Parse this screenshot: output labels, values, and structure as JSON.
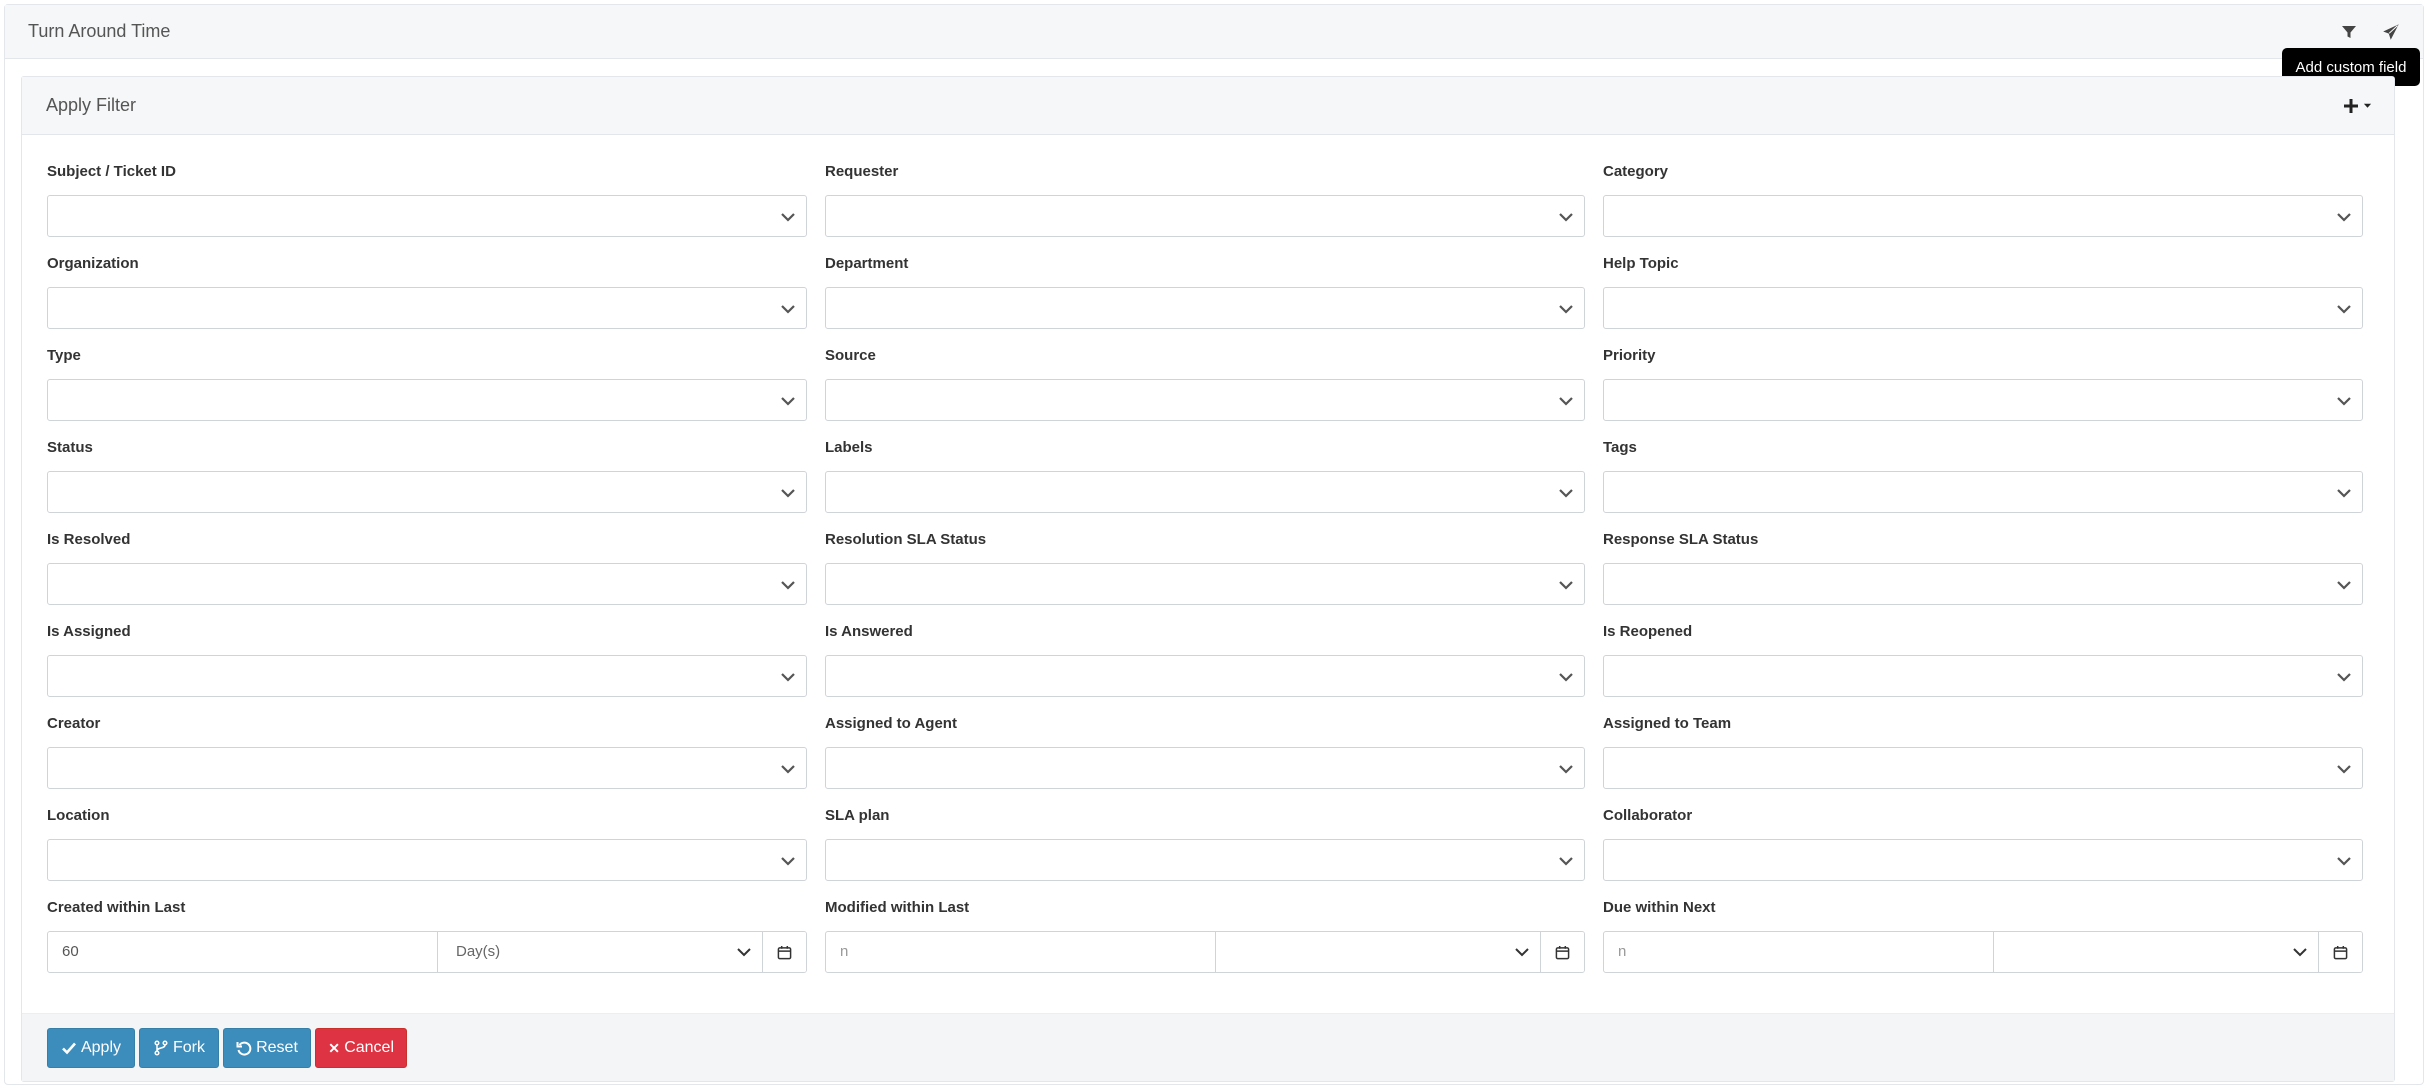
{
  "report": {
    "title": "Turn Around Time"
  },
  "tooltip": {
    "text": "Add custom field"
  },
  "filter": {
    "title": "Apply Filter",
    "fields": [
      {
        "label": "Subject / Ticket ID"
      },
      {
        "label": "Requester"
      },
      {
        "label": "Category"
      },
      {
        "label": "Organization"
      },
      {
        "label": "Department"
      },
      {
        "label": "Help Topic"
      },
      {
        "label": "Type"
      },
      {
        "label": "Source"
      },
      {
        "label": "Priority"
      },
      {
        "label": "Status"
      },
      {
        "label": "Labels"
      },
      {
        "label": "Tags"
      },
      {
        "label": "Is Resolved"
      },
      {
        "label": "Resolution SLA Status"
      },
      {
        "label": "Response SLA Status"
      },
      {
        "label": "Is Assigned"
      },
      {
        "label": "Is Answered"
      },
      {
        "label": "Is Reopened"
      },
      {
        "label": "Creator"
      },
      {
        "label": "Assigned to Agent"
      },
      {
        "label": "Assigned to Team"
      },
      {
        "label": "Location"
      },
      {
        "label": "SLA plan"
      },
      {
        "label": "Collaborator"
      }
    ],
    "ranges": [
      {
        "label": "Created within Last",
        "value": "60",
        "placeholder": "n",
        "unit": "Day(s)"
      },
      {
        "label": "Modified within Last",
        "value": "",
        "placeholder": "n",
        "unit": ""
      },
      {
        "label": "Due within Next",
        "value": "",
        "placeholder": "n",
        "unit": ""
      }
    ]
  },
  "buttons": {
    "apply": "Apply",
    "fork": "Fork",
    "reset": "Reset",
    "cancel": "Cancel"
  },
  "colors": {
    "primary": "#3c8dbc",
    "danger": "#dd3343"
  }
}
